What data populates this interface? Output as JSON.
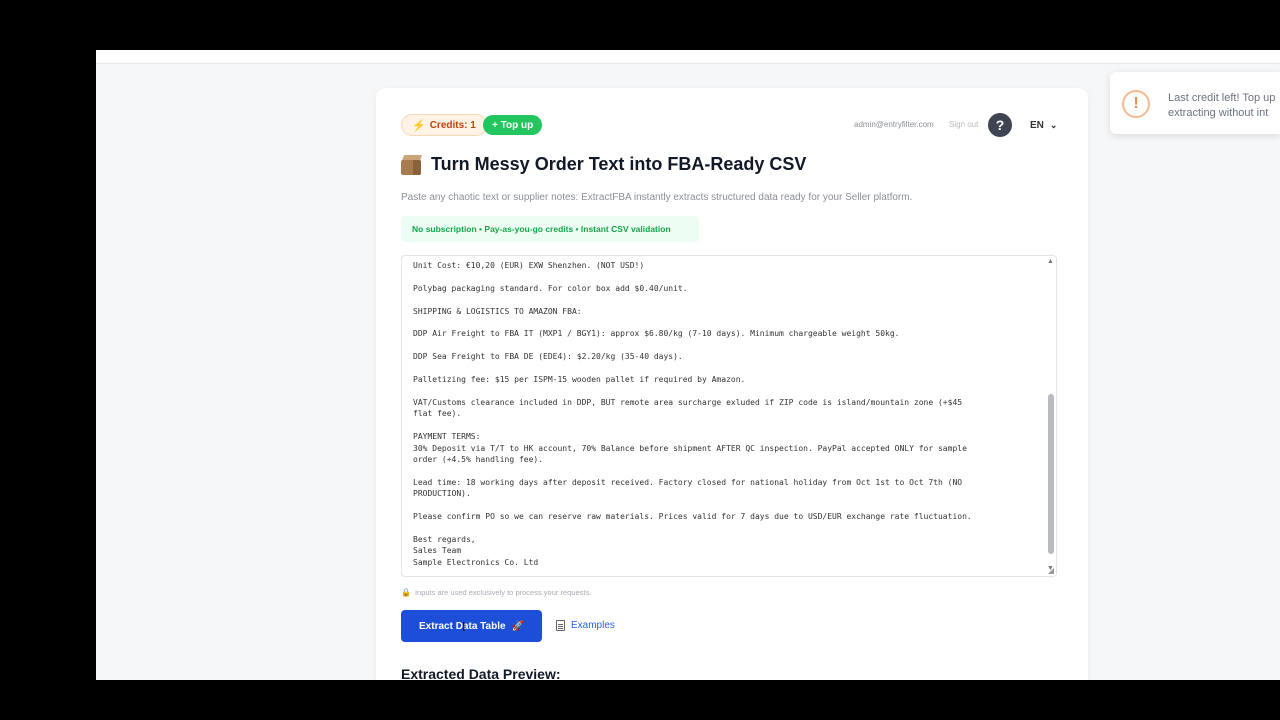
{
  "header": {
    "credits_label": "Credits: 1",
    "topup_label": "+ Top up",
    "email": "admin@entryfilter.com",
    "signout_label": "Sign out",
    "help_label": "?",
    "language": "EN"
  },
  "hero": {
    "title": "Turn Messy Order Text into FBA-Ready CSV",
    "subtitle": "Paste any chaotic text or supplier notes: ExtractFBA instantly extracts structured data ready for your Seller platform.",
    "tagline": "No subscription • Pay-as-you-go credits • Instant CSV validation"
  },
  "input": {
    "text": "Unit Cost: €10,20 (EUR) EXW Shenzhen. (NOT USD!)\n\nPolybag packaging standard. For color box add $0.40/unit.\n\nSHIPPING & LOGISTICS TO AMAZON FBA:\n\nDDP Air Freight to FBA IT (MXP1 / BGY1): approx $6.80/kg (7-10 days). Minimum chargeable weight 50kg.\n\nDDP Sea Freight to FBA DE (EDE4): $2.20/kg (35-40 days).\n\nPalletizing fee: $15 per ISPM-15 wooden pallet if required by Amazon.\n\nVAT/Customs clearance included in DDP, BUT remote area surcharge exluded if ZIP code is island/mountain zone (+$45\nflat fee).\n\nPAYMENT TERMS:\n30% Deposit via T/T to HK account, 70% Balance before shipment AFTER QC inspection. PayPal accepted ONLY for sample\norder (+4.5% handling fee).\n\nLead time: 18 working days after deposit received. Factory closed for national holiday from Oct 1st to Oct 7th (NO\nPRODUCTION).\n\nPlease confirm PO so we can reserve raw materials. Prices valid for 7 days due to USD/EUR exchange rate fluctuation.\n\nBest regards,\nSales Team\nSample Electronics Co. Ltd",
    "privacy_note": "Inputs are used exclusively to process your requests."
  },
  "actions": {
    "extract_label": "Extract Data Table",
    "examples_label": "Examples"
  },
  "preview": {
    "heading": "Extracted Data Preview:"
  },
  "toast": {
    "line1": "Last credit left! Top up",
    "line2": "extracting without int"
  },
  "colors": {
    "primary": "#1d4ed8",
    "success": "#22c55e",
    "warning": "#f08a4b"
  },
  "icons": [
    "bolt-icon",
    "help-icon",
    "chevron-down-icon",
    "box-icon",
    "lock-icon",
    "rocket-icon",
    "document-icon",
    "warning-icon"
  ]
}
